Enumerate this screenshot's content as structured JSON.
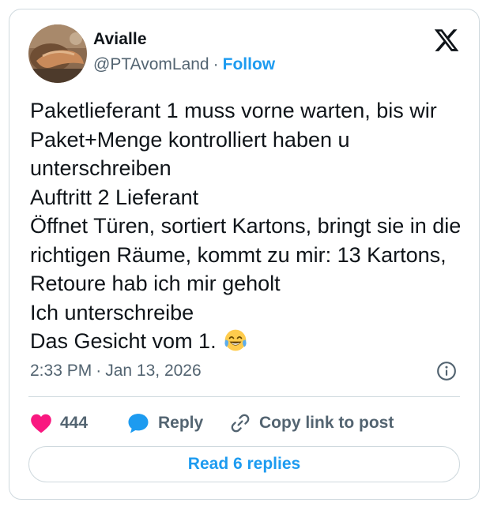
{
  "author": {
    "display_name": "Avialle",
    "handle": "@PTAvomLand",
    "separator": "·",
    "follow_label": "Follow"
  },
  "tweet": {
    "text": "Paketlieferant 1 muss vorne warten, bis wir Paket+Menge kontrolliert haben u unterschreiben\nAuftritt 2 Lieferant\nÖffnet Türen, sortiert Kartons, bringt sie in die richtigen Räume, kommt zu mir: 13 Kartons, Retoure hab ich mir geholt\nIch unterschreibe\nDas Gesicht vom 1.",
    "trailing_emoji": "face-with-tears-of-joy-emoji"
  },
  "meta": {
    "time": "2:33 PM",
    "separator": "·",
    "date": "Jan 13, 2026"
  },
  "actions": {
    "like_count": "444",
    "reply_label": "Reply",
    "copy_label": "Copy link to post"
  },
  "read_replies_label": "Read 6 replies",
  "icons": {
    "platform": "x-logo-icon",
    "info": "info-icon",
    "like": "heart-icon",
    "reply": "speech-bubble-icon",
    "copy": "link-icon"
  },
  "colors": {
    "accent": "#1d9bf0",
    "like": "#f91880",
    "secondary_text": "#536471",
    "primary_text": "#0f1419",
    "border": "#cfd9de"
  }
}
